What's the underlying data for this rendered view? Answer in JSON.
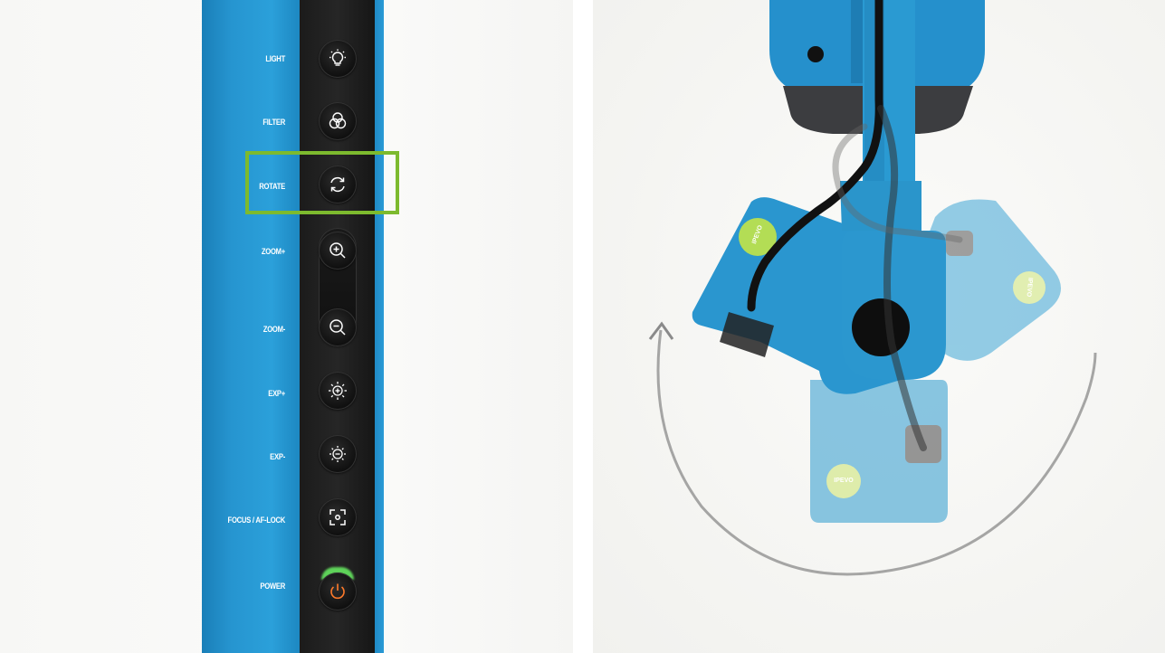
{
  "controls": {
    "light": "LIGHT",
    "filter": "FILTER",
    "rotate": "ROTATE",
    "zoom_in": "ZOOM+",
    "zoom_out": "ZOOM-",
    "exp_plus": "EXP+",
    "exp_minus": "EXP-",
    "focus": "FOCUS / AF-LOCK",
    "power": "POWER"
  },
  "icons": [
    "light-bulb-icon",
    "filter-icon",
    "rotate-icon",
    "zoom-in-icon",
    "zoom-out-icon",
    "exposure-plus-icon",
    "exposure-minus-icon",
    "focus-icon",
    "power-icon"
  ],
  "colors": {
    "arm_blue": "#2695d0",
    "highlight": "#7dba2e",
    "brand_badge": "#b6e06a"
  },
  "brand": {
    "logo_text": "IPEVO"
  }
}
